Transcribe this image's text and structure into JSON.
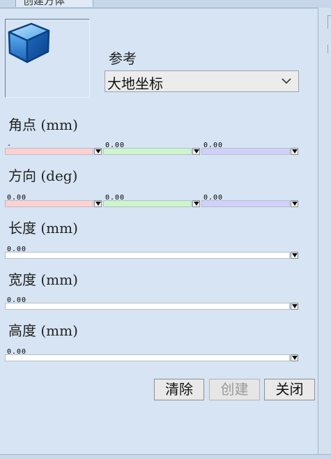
{
  "tab": {
    "title": "创建方体"
  },
  "reference": {
    "label": "参考",
    "value": "大地坐标"
  },
  "corner": {
    "label": "角点 (mm)",
    "fields": [
      {
        "value": "-",
        "color": "#ffd0d0"
      },
      {
        "value": "0.00",
        "color": "#ccf5cc"
      },
      {
        "value": "0.00",
        "color": "#d0d0fa"
      }
    ]
  },
  "direction": {
    "label": "方向 (deg)",
    "fields": [
      {
        "value": "0.00",
        "color": "#ffd0d0"
      },
      {
        "value": "0.00",
        "color": "#ccf5cc"
      },
      {
        "value": "0.00",
        "color": "#d0d0fa"
      }
    ]
  },
  "length": {
    "label": "长度 (mm)",
    "value": "0.00"
  },
  "width": {
    "label": "宽度 (mm)",
    "value": "0.00"
  },
  "height": {
    "label": "高度 (mm)",
    "value": "0.00"
  },
  "buttons": {
    "clear": "清除",
    "create": "创建",
    "close": "关闭"
  }
}
